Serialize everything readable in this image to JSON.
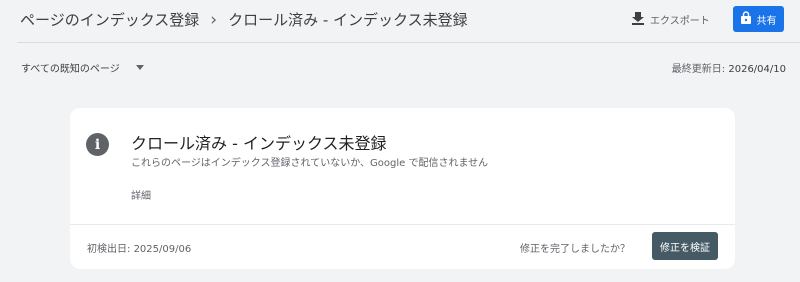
{
  "header": {
    "breadcrumb_root": "ページのインデックス登録",
    "breadcrumb_separator": "›",
    "breadcrumb_current": "クロール済み - インデックス未登録",
    "export_label": "エクスポート",
    "export_icon": "download-icon",
    "share_label": "共有",
    "share_icon": "lock-icon",
    "share_color": "#1a73e8"
  },
  "toolbar": {
    "filter_label": "すべての既知のページ",
    "updated_label": "最終更新日:",
    "updated_date": "2026/04/10"
  },
  "card": {
    "icon": "info-icon",
    "icon_glyph": "i",
    "title": "クロール済み - インデックス未登録",
    "description": "これらのページはインデックス登録されていないか、Google で配信されません",
    "details_label": "詳細",
    "first_detected_label": "初検出日:",
    "first_detected_date": "2025/09/06",
    "question": "修正を完了しましたか？",
    "validate_label": "修正を検証",
    "validate_color": "#455a64"
  }
}
